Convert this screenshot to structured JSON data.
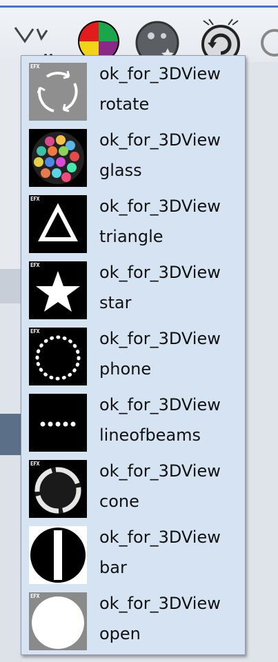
{
  "gobo_list": {
    "items": [
      {
        "category": "ok_for_3DView",
        "name": "rotate",
        "icon": "rotate-arrows-icon"
      },
      {
        "category": "ok_for_3DView",
        "name": "glass",
        "icon": "glass-colors-icon"
      },
      {
        "category": "ok_for_3DView",
        "name": "triangle",
        "icon": "triangle-icon"
      },
      {
        "category": "ok_for_3DView",
        "name": "star",
        "icon": "star-icon"
      },
      {
        "category": "ok_for_3DView",
        "name": "phone",
        "icon": "dotted-circle-icon"
      },
      {
        "category": "ok_for_3DView",
        "name": "lineofbeams",
        "icon": "line-of-dots-icon"
      },
      {
        "category": "ok_for_3DView",
        "name": "cone",
        "icon": "ring-icon"
      },
      {
        "category": "ok_for_3DView",
        "name": "bar",
        "icon": "bar-circle-icon"
      },
      {
        "category": "ok_for_3DView",
        "name": "open",
        "icon": "open-circle-icon"
      }
    ]
  },
  "toolbar": {
    "buttons": [
      "axes-icon",
      "color-wheel-icon",
      "gobo-wheel-icon",
      "rotate-gobo-icon"
    ]
  },
  "colors": {
    "dropdown_bg": "#d6e3f3",
    "accent": "#3f78c8"
  }
}
